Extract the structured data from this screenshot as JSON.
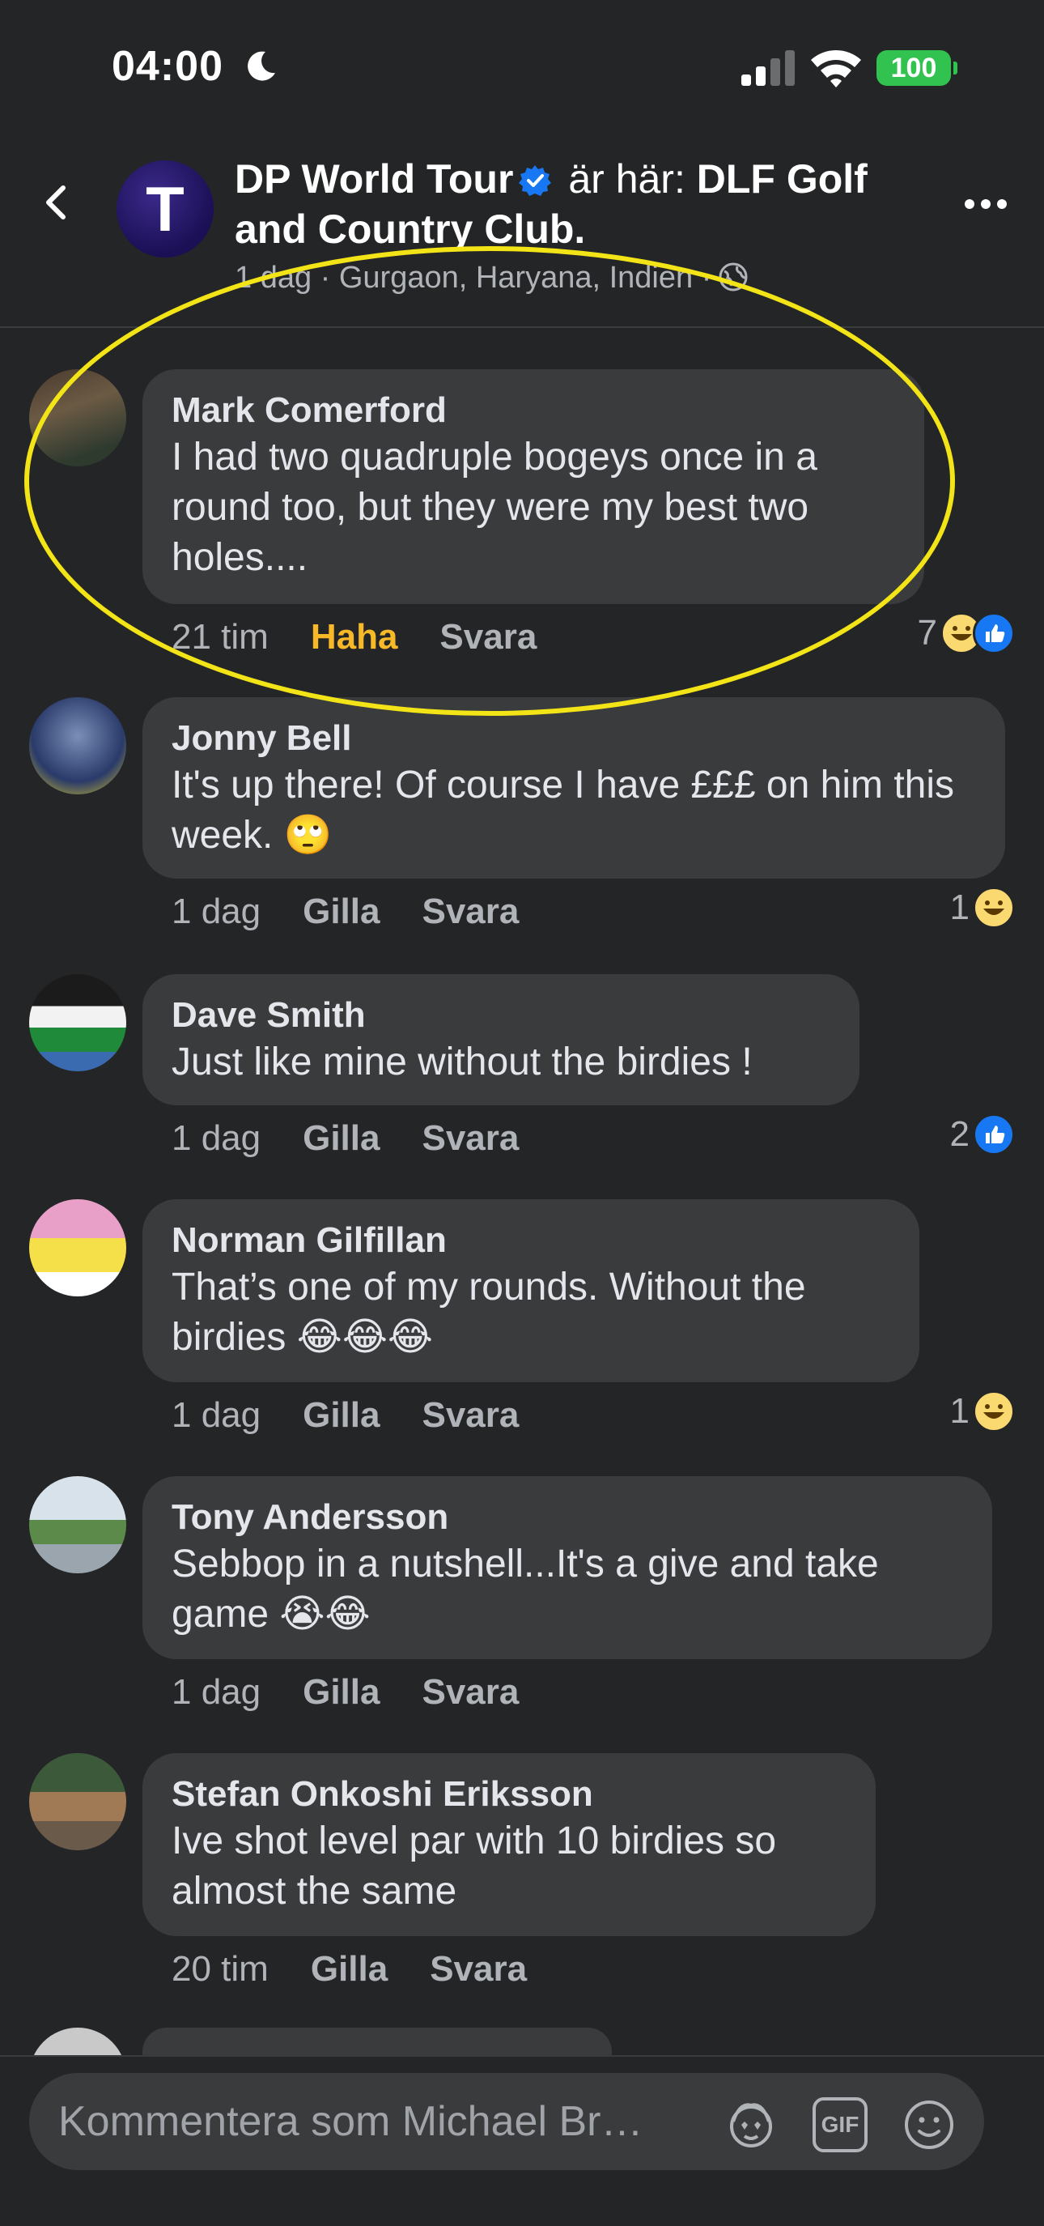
{
  "status": {
    "time": "04:00",
    "battery": "100"
  },
  "header": {
    "page_name": "DP World Tour",
    "connector": "är här:",
    "place": "DLF Golf and Country Club.",
    "meta": "1 dag · Gurgaon, Haryana, Indien ·"
  },
  "comments": [
    {
      "author": "Mark Comerford",
      "text": "I had two quadruple bogeys once in a round too, but they were my best two holes....",
      "time": "21 tim",
      "action1": "Haha",
      "action2": "Svara",
      "reaction_count": "7",
      "reactions": [
        "haha-icon",
        "like-icon"
      ]
    },
    {
      "author": "Jonny Bell",
      "text": "It's up there! Of course I have £££ on him this week. 🙄",
      "time": "1 dag",
      "action1": "Gilla",
      "action2": "Svara",
      "reaction_count": "1",
      "reactions": [
        "haha-icon"
      ]
    },
    {
      "author": "Dave Smith",
      "text": "Just like mine without the birdies !",
      "time": "1 dag",
      "action1": "Gilla",
      "action2": "Svara",
      "reaction_count": "2",
      "reactions": [
        "like-icon"
      ]
    },
    {
      "author": "Norman Gilfillan",
      "text": "That’s one of my rounds. Without the birdies 😂😂😂",
      "time": "1 dag",
      "action1": "Gilla",
      "action2": "Svara",
      "reaction_count": "1",
      "reactions": [
        "haha-icon"
      ]
    },
    {
      "author": "Tony Andersson",
      "text": "Sebbop in a nutshell...It's a give and take game 😭😂",
      "time": "1 dag",
      "action1": "Gilla",
      "action2": "Svara",
      "reaction_count": "",
      "reactions": []
    },
    {
      "author": "Stefan Onkoshi Eriksson",
      "text": "Ive shot level par with 10 birdies so almost the same",
      "time": "20 tim",
      "action1": "Gilla",
      "action2": "Svara",
      "reaction_count": "",
      "reactions": []
    }
  ],
  "input": {
    "placeholder": "Kommentera som Michael Br…",
    "gif_label": "GIF"
  },
  "colors": {
    "background": "#242526",
    "bubble": "#3a3b3c",
    "haha_active": "#f7b928",
    "highlight": "#f2e417",
    "like_blue": "#1877f2"
  }
}
